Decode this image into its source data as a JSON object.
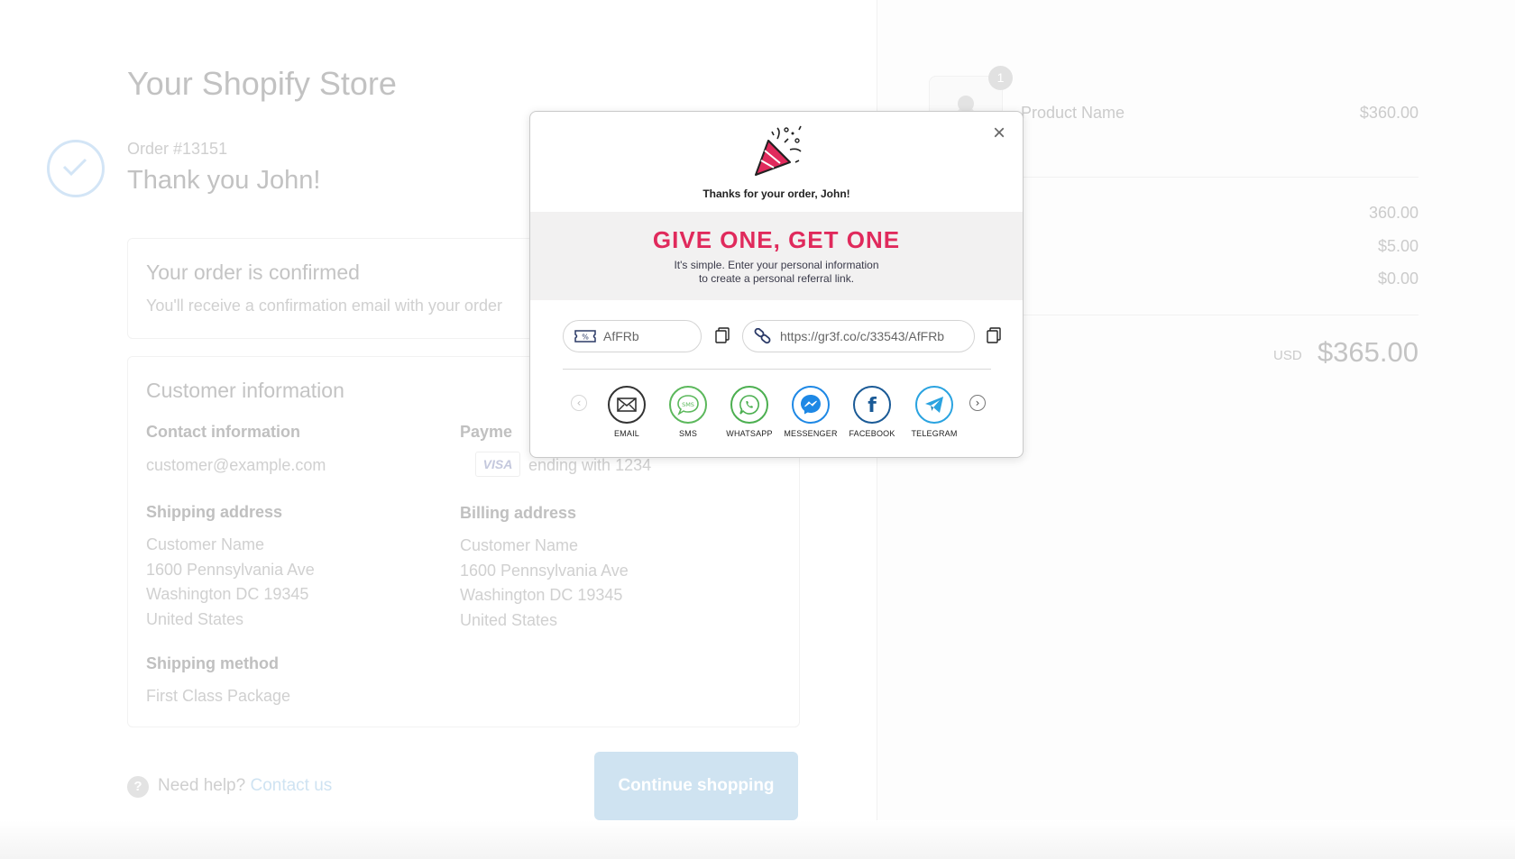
{
  "store": {
    "title": "Your Shopify Store",
    "order_number": "Order #13151",
    "thank_you": "Thank you John!"
  },
  "confirmation": {
    "heading": "Your order is confirmed",
    "text": "You'll receive a confirmation email with your order"
  },
  "customer": {
    "heading": "Customer information",
    "contact_label": "Contact information",
    "contact_email": "customer@example.com",
    "payment_label": "Payme",
    "payment_card": "VISA",
    "payment_text": "ending with 1234",
    "shipping_label": "Shipping address",
    "shipping_lines": [
      "Customer Name",
      "1600 Pennsylvania Ave",
      "Washington DC 19345",
      "United States"
    ],
    "billing_label": "Billing address",
    "billing_lines": [
      "Customer Name",
      "1600 Pennsylvania Ave",
      "Washington DC 19345",
      "United States"
    ],
    "method_label": "Shipping method",
    "method_value": "First Class Package"
  },
  "footer": {
    "help_icon": "?",
    "help_text": "Need help?",
    "help_link": "Contact us",
    "continue_label": "Continue shopping"
  },
  "summary": {
    "product_name": "Product Name",
    "product_price": "$360.00",
    "quantity": "1",
    "subtotal": "360.00",
    "shipping": "$5.00",
    "taxes": "$0.00",
    "currency": "USD",
    "total": "$365.00"
  },
  "modal": {
    "close": "×",
    "thanks": "Thanks for your order, John!",
    "headline": "GIVE ONE, GET ONE",
    "sub_line1": "It's simple. Enter your personal information",
    "sub_line2": "to create a personal referral link.",
    "coupon_code": "AfFRb",
    "referral_link": "https://gr3f.co/c/33543/AfFRb",
    "prev": "‹",
    "next": "›",
    "share_buttons": [
      "EMAIL",
      "SMS",
      "WHATSAPP",
      "MESSENGER",
      "FACEBOOK",
      "TELEGRAM"
    ],
    "sms_icon_text": "SMS",
    "facebook_icon_text": "f"
  },
  "colors": {
    "accent": "#e02a5c",
    "email": "#333333",
    "sms": "#5cb85c",
    "whatsapp": "#4caf50",
    "messenger": "#1e88e5",
    "facebook": "#1a5a96",
    "telegram": "#2aa3e0"
  }
}
